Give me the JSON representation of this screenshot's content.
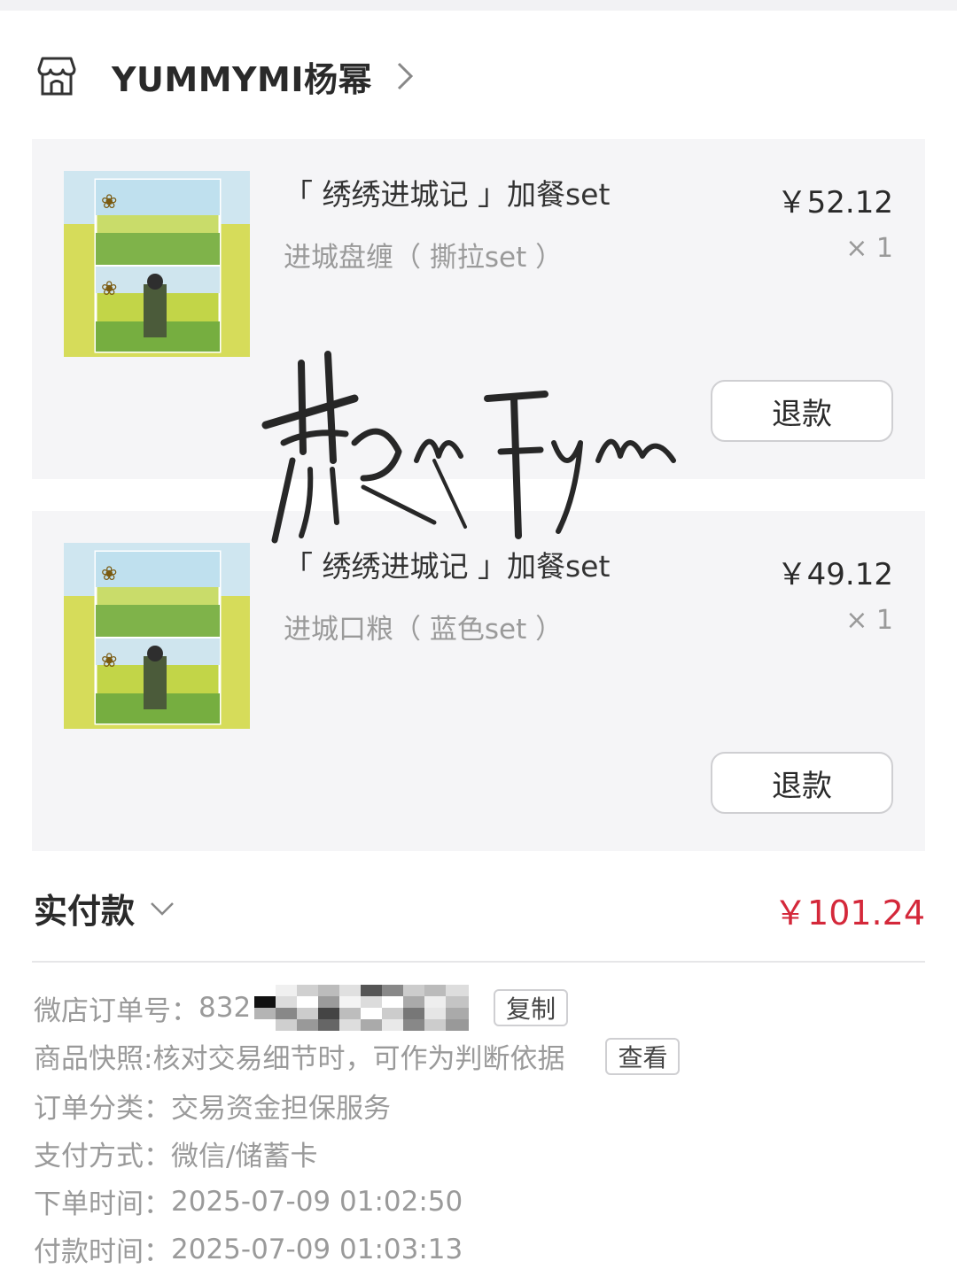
{
  "shop": {
    "name": "YUMMYMI杨幂",
    "icon": "store-icon"
  },
  "items": [
    {
      "title": "「 绣绣进城记 」加餐set",
      "variant": "进城盘缠（ 撕拉set ）",
      "price": "￥52.12",
      "qty": "× 1",
      "refund_label": "退款"
    },
    {
      "title": "「 绣绣进城记 」加餐set",
      "variant": "进城口粮（ 蓝色set ）",
      "price": "￥49.12",
      "qty": "× 1",
      "refund_label": "退款"
    }
  ],
  "total": {
    "label": "实付款",
    "amount": "￥101.24"
  },
  "order_info": {
    "order_no_label": "微店订单号：",
    "order_no_visible": "832",
    "copy_label": "复制",
    "snapshot_label": "商品快照: ",
    "snapshot_text": "核对交易细节时，可作为判断依据",
    "view_label": "查看",
    "category_label": "订单分类：",
    "category_value": "交易资金担保服务",
    "payment_label": "支付方式：",
    "payment_value": "微信/储蓄卡",
    "order_time_label": "下单时间：",
    "order_time_value": "2025-07-09 01:02:50",
    "pay_time_label": "付款时间：",
    "pay_time_value": "2025-07-09 01:03:13"
  },
  "colors": {
    "accent_price": "#d4283a",
    "card_bg": "#f5f5f7"
  }
}
